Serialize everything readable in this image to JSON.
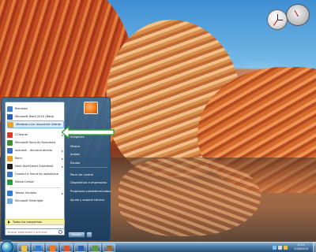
{
  "desktop": {},
  "start_menu": {
    "programs": [
      {
        "label": "Recortes",
        "color": "#3b7fd1",
        "icon": "scissors-icon",
        "has_arrow": false
      },
      {
        "label": "Microsoft Word 2010 (Beta)",
        "color": "#2b5fb3",
        "icon": "word-icon",
        "has_arrow": false
      },
      {
        "label": "Windows Live Important Infante",
        "color": "#f0a020",
        "icon": "windows-live-icon",
        "has_arrow": false
      },
      {
        "label": "CCleaner",
        "color": "#d73a2a",
        "icon": "ccleaner-icon",
        "has_arrow": true
      },
      {
        "label": "Microsoft Security Essentials",
        "color": "#3a8f2e",
        "icon": "security-icon",
        "has_arrow": false
      },
      {
        "label": "wrenesh - dicciona directo",
        "color": "#3a6fbf",
        "icon": "dictionary-icon",
        "has_arrow": true
      },
      {
        "label": "Paint",
        "color": "#e89a2b",
        "icon": "paint-icon",
        "has_arrow": true
      },
      {
        "label": "Nero StartSmart Essentials",
        "color": "#202020",
        "icon": "nero-icon",
        "has_arrow": true
      },
      {
        "label": "Contact a friend for assistance",
        "color": "#3a78c8",
        "icon": "assistance-icon",
        "has_arrow": false
      },
      {
        "label": "Media Center",
        "color": "#2f9a3a",
        "icon": "media-center-icon",
        "has_arrow": false
      },
      {
        "label": "Tareas iniciales",
        "color": "#2d7bd6",
        "icon": "getting-started-icon",
        "has_arrow": true
      },
      {
        "label": "Microsoft Silverlight",
        "color": "#7aa7d9",
        "icon": "silverlight-icon",
        "has_arrow": false
      }
    ],
    "all_programs_label": "Todos los programas",
    "search_placeholder": "Buscar programas y archivos",
    "right_links": [
      {
        "label": "Imágenes"
      },
      {
        "label": "Música"
      },
      {
        "label": "Juegos"
      },
      {
        "label": "Equipo"
      },
      {
        "label": "Panel de control"
      },
      {
        "label": "Dispositivos e impresoras"
      },
      {
        "label": "Programas predeterminados"
      },
      {
        "label": "Ayuda y soporte técnico"
      }
    ],
    "shutdown_label": "Apagar"
  },
  "taskbar": {
    "buttons": [
      {
        "icon": "explorer-icon",
        "color": "#f0c040"
      },
      {
        "icon": "ie-icon",
        "color": "#2a7fd4"
      },
      {
        "icon": "media-player-icon",
        "color": "#f07a1b"
      },
      {
        "icon": "firefox-icon",
        "color": "#e0522b"
      },
      {
        "icon": "word-icon",
        "color": "#2b5fb3"
      },
      {
        "icon": "app-icon",
        "color": "#5b9c3a"
      },
      {
        "icon": "app-icon",
        "color": "#9c6b3a"
      }
    ],
    "time": "12:21",
    "date": "21/06/2010"
  }
}
